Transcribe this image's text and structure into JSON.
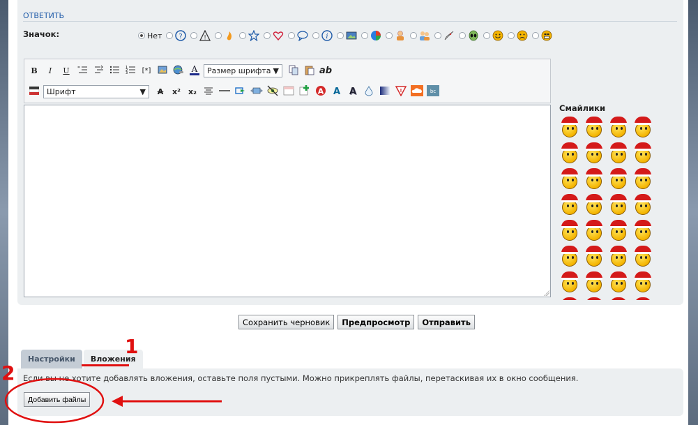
{
  "reply": {
    "title": "ОТВЕТИТЬ",
    "icon_label": "Значок:",
    "icon_none": "Нет",
    "icons": [
      "question-icon",
      "warning-icon",
      "fire-icon",
      "star-icon",
      "heart-icon",
      "speech-bubble-icon",
      "info-icon",
      "image-icon",
      "pie-chart-icon",
      "user-icon",
      "users-icon",
      "rocket-icon",
      "alien-icon",
      "smiley-happy-icon",
      "smiley-sad-icon",
      "smiley-grin-icon"
    ]
  },
  "toolbar": {
    "bold": "B",
    "italic": "I",
    "underline": "U",
    "font_size_select": "Размер шрифта",
    "font_select": "Шрифт",
    "ab": "ab",
    "superscript": "x²",
    "subscript": "x₂",
    "spoiler": "[*]"
  },
  "smilies": {
    "title": "Смайлики",
    "count": 32
  },
  "buttons": {
    "save_draft": "Сохранить черновик",
    "preview": "Предпросмотр",
    "submit": "Отправить"
  },
  "tabs": {
    "settings": "Настройки",
    "attachments": "Вложения"
  },
  "attachments": {
    "hint": "Если вы не хотите добавлять вложения, оставьте поля пустыми. Можно прикреплять файлы, перетаскивая их в окно сообщения.",
    "add_files": "Добавить файлы"
  },
  "annotations": {
    "one": "1",
    "two": "2"
  },
  "colors": {
    "annotation": "#e01010",
    "title": "#1e5aa8",
    "panel": "#eceff1"
  }
}
